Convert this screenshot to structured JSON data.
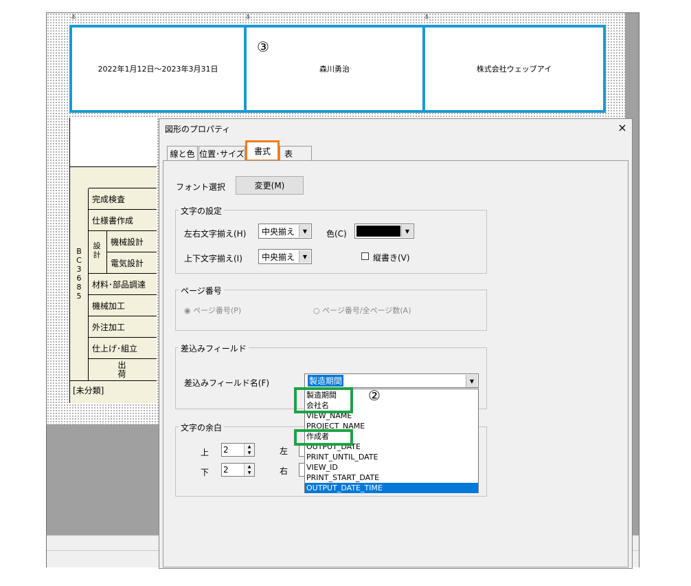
{
  "sheet": {
    "header_fields": [
      "2022年1月12日～2023年3月31日",
      "森川勇治",
      "株式会社ウェッブアイ"
    ],
    "marker3": "③",
    "anchor_icon": "⚓",
    "table": {
      "vertical_label": "BC3685",
      "design_label": "設計",
      "rows": [
        "完成検査",
        "仕様書作成",
        "機械設計",
        "電気設計",
        "材料･部品調達",
        "機械加工",
        "外注加工",
        "仕上げ･組立",
        "出荷"
      ],
      "unclassified": "[未分類]"
    }
  },
  "dialog": {
    "title": "図形のプロパティ",
    "close": "×",
    "tabs": [
      "線と色",
      "位置･サイズ",
      "書式",
      "表"
    ],
    "font_label": "フォント選択",
    "change_button": "変更(M)",
    "text_settings": {
      "legend": "文字の設定",
      "h_align_label": "左右文字揃え(H)",
      "h_align_value": "中央揃え",
      "color_label": "色(C)",
      "color_value": "#000000",
      "v_align_label": "上下文字揃え(I)",
      "v_align_value": "中央揃え",
      "vertical_label": "縦書き(V)"
    },
    "page_number": {
      "legend": "ページ番号",
      "opt1": "ページ番号(P)",
      "opt2": "ページ番号/全ページ数(A)"
    },
    "merge_field": {
      "legend": "差込みフィールド",
      "name_label": "差込みフィールド名(F)",
      "selected": "製造期間",
      "options": [
        "製造期間",
        "会社名",
        "VIEW_NAME",
        "PROJECT_NAME",
        "作成者",
        "OUTPUT_DATE",
        "PRINT_UNTIL_DATE",
        "VIEW_ID",
        "PRINT_START_DATE",
        "OUTPUT_DATE_TIME"
      ],
      "highlighted_option": "OUTPUT_DATE_TIME"
    },
    "margin": {
      "legend": "文字の余白",
      "top_label": "上",
      "top_value": "2",
      "bottom_label": "下",
      "bottom_value": "2",
      "left_label": "左",
      "right_label": "右"
    },
    "marker2": "②"
  },
  "colors": {
    "highlight_blue": "#1a9ad6",
    "highlight_green": "#1ca444",
    "highlight_orange": "#f07d1a",
    "selection": "#0078d7"
  }
}
